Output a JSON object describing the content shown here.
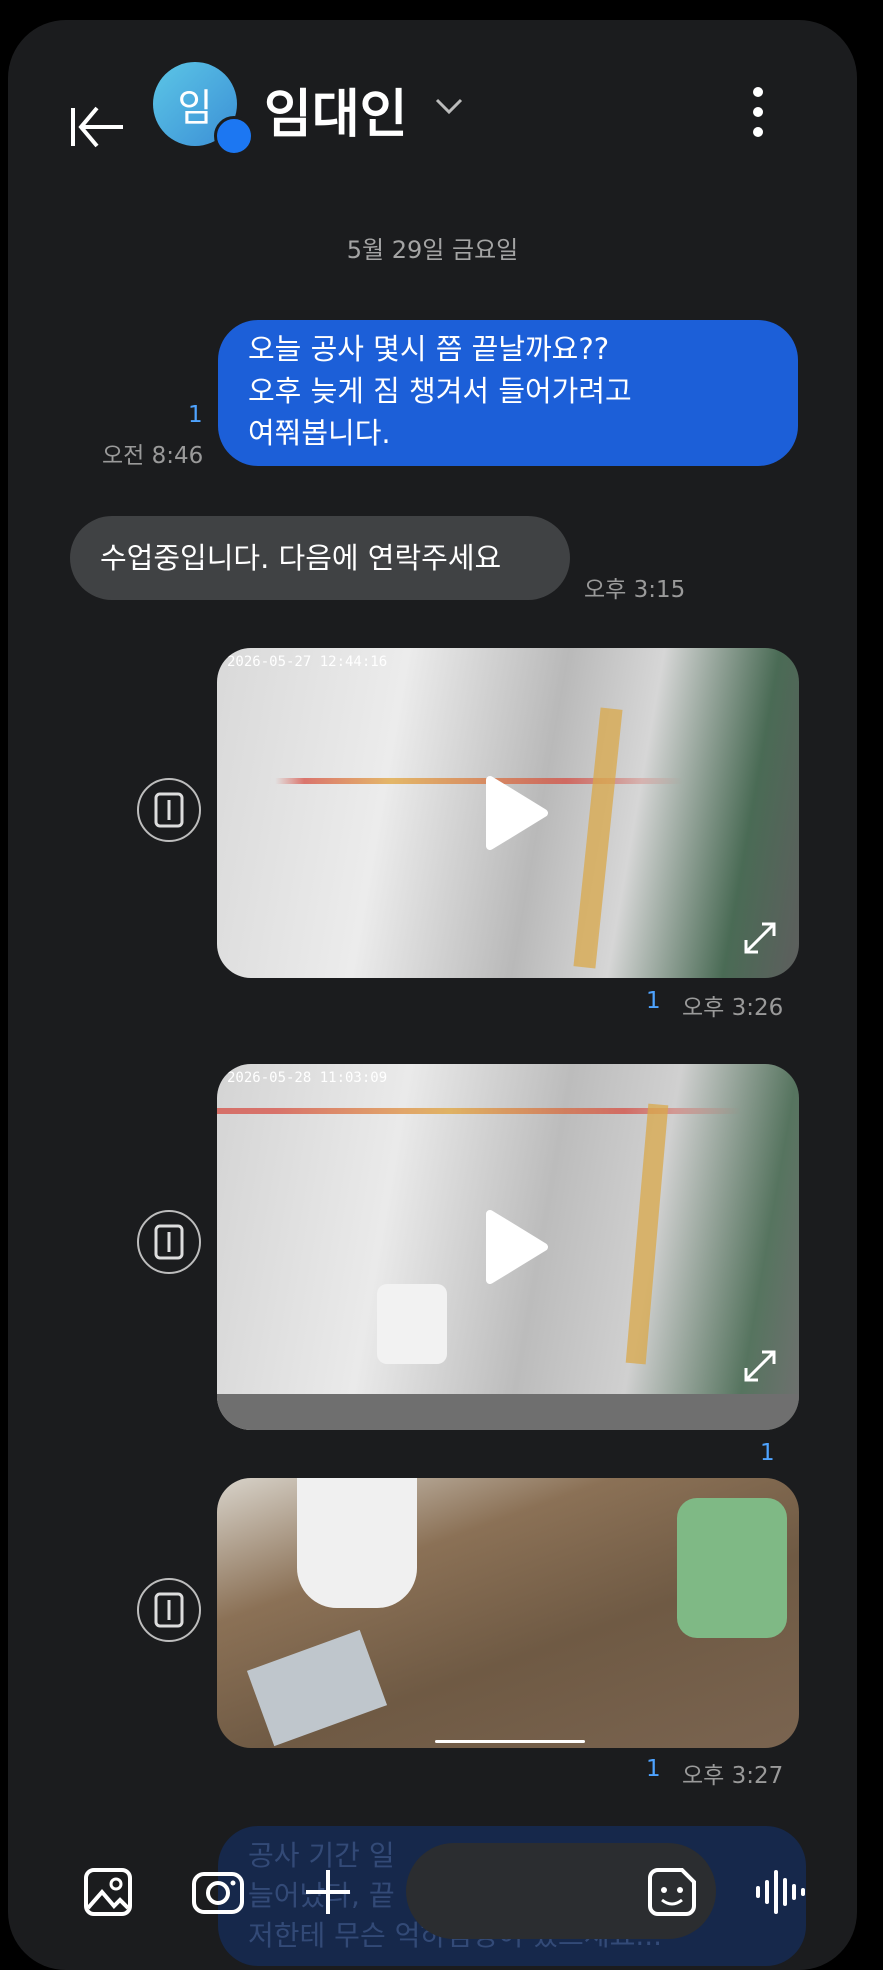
{
  "header": {
    "contact_name": "임대인",
    "avatar_initial": "임"
  },
  "date_divider": "5월 29일 금요일",
  "messages": {
    "outgoing_1": {
      "lines": [
        "오늘 공사 몇시 쯤 끝날까요??",
        "오후 늦게 짐 챙겨서 들어가려고",
        "여쭤봅니다."
      ],
      "unread": "1",
      "time": "오전 8:46"
    },
    "incoming_1": {
      "text": "수업중입니다. 다음에 연락주세요",
      "time": "오후 3:15"
    },
    "video_1": {
      "timestamp": "2026-05-27 12:44:16",
      "unread": "1",
      "time": "오후 3:26"
    },
    "video_2": {
      "timestamp": "2026-05-28 11:03:09",
      "unread": "1"
    },
    "image_1": {
      "unread": "1",
      "time": "오후 3:27"
    }
  },
  "composer": {
    "ghost_text": [
      "공사 기간 일",
      "늘어났다, 끝",
      "저한테 무슨 억하심정이 있으세요..."
    ]
  },
  "colors": {
    "outgoing": "#1c5fd8",
    "incoming": "#404244",
    "accent": "#4ea3ff"
  }
}
